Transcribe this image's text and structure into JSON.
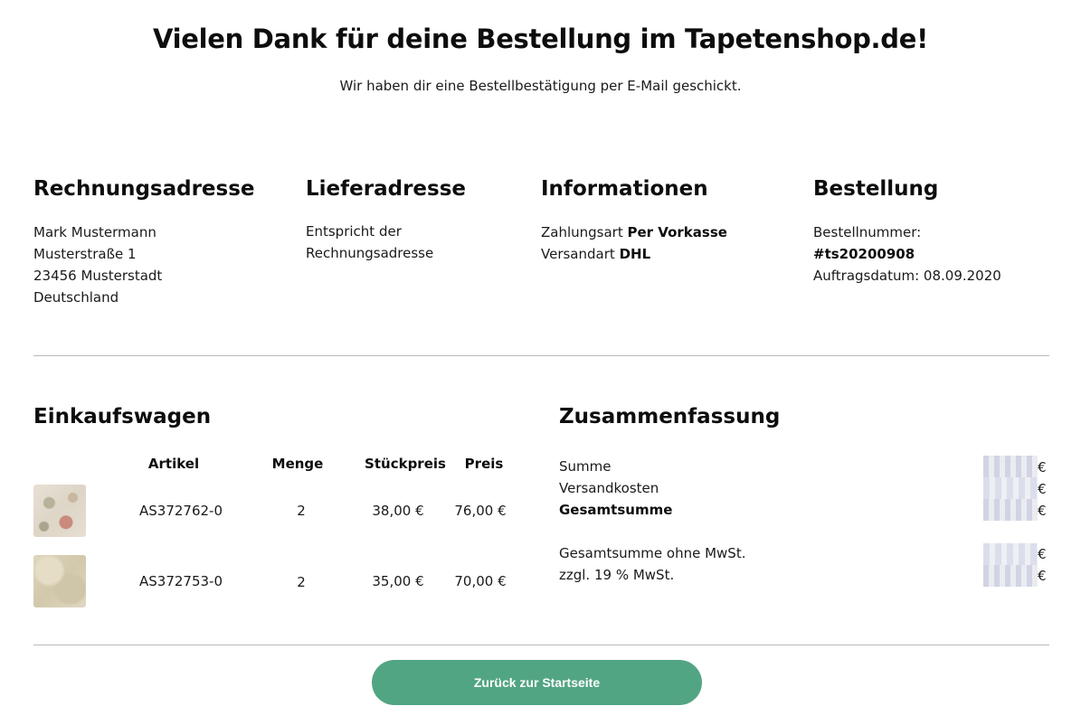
{
  "header": {
    "title": "Vielen Dank für deine Bestellung im Tapetenshop.de!",
    "subtitle": "Wir haben dir eine Bestellbestätigung per E-Mail geschickt."
  },
  "billing": {
    "heading": "Rechnungsadresse",
    "lines": [
      "Mark Mustermann",
      "Musterstraße 1",
      "23456 Musterstadt",
      "Deutschland"
    ]
  },
  "shipping": {
    "heading": "Lieferadresse",
    "lines": [
      "Entspricht der",
      "Rechnungsadresse"
    ]
  },
  "info": {
    "heading": "Informationen",
    "payment_label": "Zahlungsart",
    "payment_value": "Per Vorkasse",
    "shipping_label": "Versandart",
    "shipping_value": "DHL"
  },
  "order": {
    "heading": "Bestellung",
    "number_label": "Bestellnummer:",
    "number_value": "#ts20200908",
    "date_label": "Auftragsdatum:",
    "date_value": "08.09.2020"
  },
  "cart": {
    "heading": "Einkaufswagen",
    "columns": [
      "Artikel",
      "Menge",
      "Stückpreis",
      "Preis"
    ],
    "items": [
      {
        "article": "AS372762-0",
        "quantity": "2",
        "unit_price": "38,00 €",
        "price": "76,00 €"
      },
      {
        "article": "AS372753-0",
        "quantity": "2",
        "unit_price": "35,00 €",
        "price": "70,00 €"
      }
    ]
  },
  "summary": {
    "heading": "Zusammenfassung",
    "subtotal_label": "Summe",
    "shipping_cost_label": "Versandkosten",
    "total_label": "Gesamtsumme",
    "net_total_label": "Gesamtsumme ohne MwSt.",
    "vat_label": "zzgl. 19 % MwSt.",
    "currency": "€"
  },
  "button": {
    "back_label": "Zurück zur Startseite"
  },
  "colors": {
    "button": "#52a583",
    "divider": "#b9b9b9"
  }
}
